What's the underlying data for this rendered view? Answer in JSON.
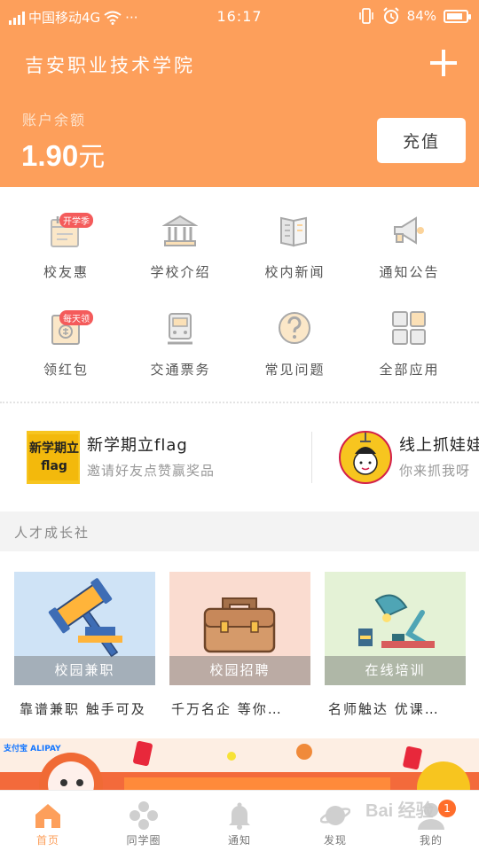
{
  "status_bar": {
    "carrier": "中国移动4G",
    "more": "···",
    "time": "16:17",
    "battery": "84%",
    "battery_level": 0.84
  },
  "header": {
    "school_name": "吉安职业技术学院",
    "balance_label": "账户余额",
    "balance_amount": "1.90",
    "balance_unit": "元",
    "recharge_label": "充值",
    "accent_color": "#fd9f5b"
  },
  "grid": [
    {
      "label": "校友惠",
      "icon": "calendar-icon",
      "badge": "开学季"
    },
    {
      "label": "学校介绍",
      "icon": "school-building-icon",
      "badge": ""
    },
    {
      "label": "校内新闻",
      "icon": "newspaper-icon",
      "badge": ""
    },
    {
      "label": "通知公告",
      "icon": "megaphone-icon",
      "badge": ""
    },
    {
      "label": "领红包",
      "icon": "red-envelope-icon",
      "badge": "每天领"
    },
    {
      "label": "交通票务",
      "icon": "train-icon",
      "badge": ""
    },
    {
      "label": "常见问题",
      "icon": "question-icon",
      "badge": ""
    },
    {
      "label": "全部应用",
      "icon": "apps-grid-icon",
      "badge": ""
    }
  ],
  "promos": [
    {
      "title": "新学期立flag",
      "subtitle": "邀请好友点赞赢奖品",
      "thumb_text": "新学期立flag"
    },
    {
      "title": "线上抓娃娃",
      "subtitle": "你来抓我呀"
    }
  ],
  "section": {
    "title": "人才成长社"
  },
  "cards": [
    {
      "caption": "校园兼职",
      "desc": "靠谱兼职 触手可及",
      "icon": "gavel-icon"
    },
    {
      "caption": "校园招聘",
      "desc": "千万名企 等你…",
      "icon": "briefcase-icon"
    },
    {
      "caption": "在线培训",
      "desc": "名师触达 优课…",
      "icon": "desk-lamp-icon"
    }
  ],
  "banner": {
    "brand": "支付宝",
    "brand_sub": "ALIPAY"
  },
  "tabbar": [
    {
      "label": "首页",
      "icon": "home-icon",
      "active": true
    },
    {
      "label": "同学圈",
      "icon": "circles-icon",
      "active": false
    },
    {
      "label": "通知",
      "icon": "bell-icon",
      "active": false
    },
    {
      "label": "发现",
      "icon": "planet-icon",
      "active": false
    },
    {
      "label": "我的",
      "icon": "user-icon",
      "active": false
    }
  ],
  "notification_count": "1",
  "watermark": "Bai 经验"
}
